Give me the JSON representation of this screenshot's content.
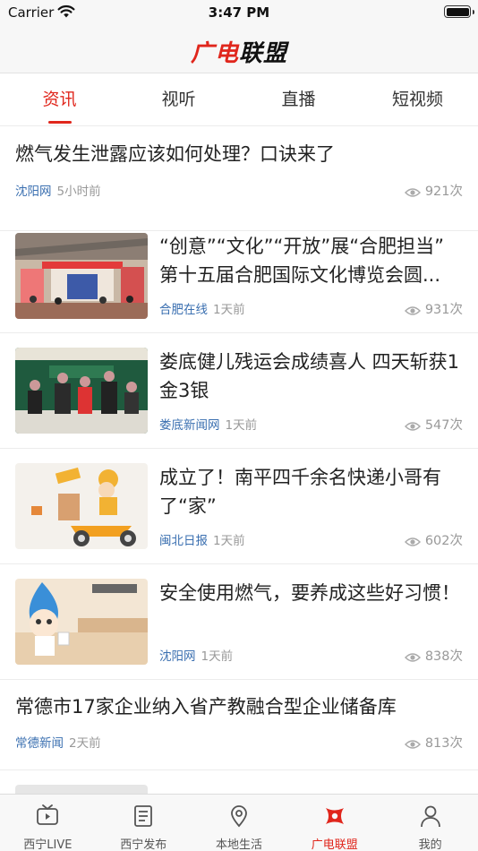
{
  "status": {
    "carrier": "Carrier",
    "time": "3:47 PM"
  },
  "header": {
    "logo_part1": "广电",
    "logo_part2": "联盟"
  },
  "tabs": [
    {
      "label": "资讯",
      "active": true
    },
    {
      "label": "视听",
      "active": false
    },
    {
      "label": "直播",
      "active": false
    },
    {
      "label": "短视频",
      "active": false
    }
  ],
  "articles": [
    {
      "title": "燃气发生泄露应该如何处理？口诀来了",
      "source": "沈阳网",
      "time": "5小时前",
      "views": "921次",
      "thumbnail": null
    },
    {
      "title": "“创意”“文化”“开放”展“合肥担当” 第十五届合肥国际文化博览会圆...",
      "source": "合肥在线",
      "time": "1天前",
      "views": "931次",
      "thumbnail": "expo-hall-photo"
    },
    {
      "title": "娄底健儿残运会成绩喜人 四天斩获1金3银",
      "source": "娄底新闻网",
      "time": "1天前",
      "views": "547次",
      "thumbnail": "award-ceremony-photo"
    },
    {
      "title": "成立了！南平四千余名快递小哥有了“家”",
      "source": "闽北日报",
      "time": "1天前",
      "views": "602次",
      "thumbnail": "courier-scooter-illustration"
    },
    {
      "title": "安全使用燃气，要养成这些好习惯！",
      "source": "沈阳网",
      "time": "1天前",
      "views": "838次",
      "thumbnail": "gas-mascot-illustration"
    },
    {
      "title": "常德市17家企业纳入省产教融合型企业储备库",
      "source": "常德新闻",
      "time": "2天前",
      "views": "813次",
      "thumbnail": null
    }
  ],
  "bottom_nav": [
    {
      "label": "西宁LIVE",
      "icon": "tv-icon",
      "active": false
    },
    {
      "label": "西宁发布",
      "icon": "document-list-icon",
      "active": false
    },
    {
      "label": "本地生活",
      "icon": "location-pin-icon",
      "active": false
    },
    {
      "label": "广电联盟",
      "icon": "alliance-logo-icon",
      "active": true
    },
    {
      "label": "我的",
      "icon": "user-icon",
      "active": false
    }
  ],
  "colors": {
    "accent": "#e0261c",
    "source": "#3a6fb0",
    "muted": "#999999"
  }
}
